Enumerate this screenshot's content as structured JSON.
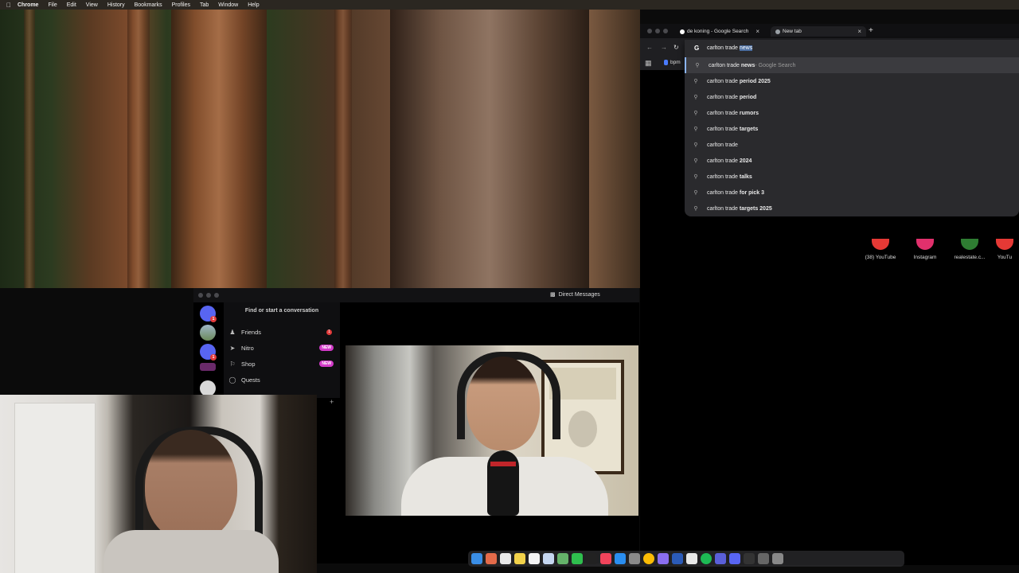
{
  "menubar": {
    "app": "Chrome",
    "items": [
      "File",
      "Edit",
      "View",
      "History",
      "Bookmarks",
      "Profiles",
      "Tab",
      "Window",
      "Help"
    ]
  },
  "discord": {
    "title": "Direct Messages",
    "find_label": "Find or start a conversation",
    "rows": [
      {
        "label": "Friends",
        "icon": "friends-icon",
        "badge": "1"
      },
      {
        "label": "Nitro",
        "icon": "nitro-icon",
        "tag": "NEW"
      },
      {
        "label": "Shop",
        "icon": "shop-icon",
        "tag": "NEW"
      },
      {
        "label": "Quests",
        "icon": "quests-icon"
      }
    ],
    "server_badges": [
      "1",
      "1"
    ]
  },
  "chrome": {
    "tabs": [
      {
        "title": "de koning - Google Search",
        "icon": "google-icon",
        "active": false
      },
      {
        "title": "New tab",
        "icon": "chrome-icon",
        "active": true
      }
    ],
    "new_tab_glyph": "+",
    "bookmark": "bpm",
    "omnibox": {
      "typed": "carlton trade ",
      "autocomplete": "news",
      "suggestions": [
        {
          "plain": "carlton trade ",
          "bold": "news",
          "suffix": " - Google Search"
        },
        {
          "plain": "carlton trade ",
          "bold": "period 2025",
          "suffix": ""
        },
        {
          "plain": "carlton trade ",
          "bold": "period",
          "suffix": ""
        },
        {
          "plain": "carlton trade ",
          "bold": "rumors",
          "suffix": ""
        },
        {
          "plain": "carlton trade ",
          "bold": "targets",
          "suffix": ""
        },
        {
          "plain": "carlton trade",
          "bold": "",
          "suffix": ""
        },
        {
          "plain": "carlton trade ",
          "bold": "2024",
          "suffix": ""
        },
        {
          "plain": "carlton trade ",
          "bold": "talks",
          "suffix": ""
        },
        {
          "plain": "carlton trade ",
          "bold": "for pick 3",
          "suffix": ""
        },
        {
          "plain": "carlton trade ",
          "bold": "targets 2025",
          "suffix": ""
        }
      ]
    },
    "shortcuts": [
      {
        "label": "(38) YouTube",
        "color": "#e53935"
      },
      {
        "label": "Instagram",
        "color": "#e1306c"
      },
      {
        "label": "realestate.c...",
        "color": "#2e7d32"
      },
      {
        "label": "YouTu",
        "color": "#e53935"
      }
    ]
  },
  "dock": {
    "icons": [
      "finder-icon",
      "launchpad-icon",
      "safari-icon",
      "notes-icon",
      "calendar-icon",
      "photos-icon",
      "maps-icon",
      "facetime-icon",
      "terminal-icon",
      "music-icon",
      "app-store-icon",
      "settings-icon",
      "chrome-icon",
      "arc-icon",
      "word-icon",
      "openai-icon",
      "spotify-icon",
      "stars-icon",
      "discord-icon",
      "obs-icon",
      "window-icon",
      "trash-icon"
    ]
  }
}
